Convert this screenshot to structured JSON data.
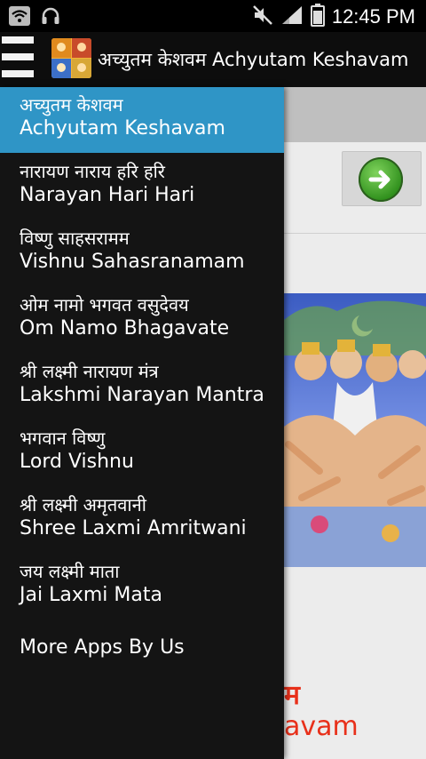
{
  "status_bar": {
    "time": "12:45 PM",
    "icons": [
      "wifi-icon",
      "headphones-icon",
      "mute-icon",
      "signal-icon",
      "battery-icon"
    ]
  },
  "action_bar": {
    "title": "अच्युतम केशवम Achyutam Keshavam",
    "icons": [
      "menu-icon",
      "app-icon"
    ]
  },
  "drawer": {
    "items": [
      {
        "hi": "अच्युतम केशवम",
        "en": "Achyutam Keshavam",
        "selected": true
      },
      {
        "hi": "नारायण नाराय हरि हरि",
        "en": "Narayan Hari Hari"
      },
      {
        "hi": "विष्णु साहसरामम",
        "en": "Vishnu Sahasranamam"
      },
      {
        "hi": "ओम नामो भगवत वसुदेवय",
        "en": "Om Namo Bhagavate"
      },
      {
        "hi": "श्री लक्ष्मी नारायण मंत्र",
        "en": "Lakshmi Narayan Mantra"
      },
      {
        "hi": "भगवान विष्णु",
        "en": "Lord Vishnu"
      },
      {
        "hi": "श्री लक्ष्मी अमृतवानी",
        "en": "Shree Laxmi Amritwani"
      },
      {
        "hi": "जय लक्ष्मी माता",
        "en": "Jai Laxmi Mata"
      }
    ],
    "more_apps": "More Apps By Us"
  },
  "content": {
    "title_hi_partial": "म",
    "title_en_partial": "avam",
    "next_icon": "arrow-right-icon"
  },
  "colors": {
    "selected_bg": "#2f95c6",
    "drawer_bg": "#141414",
    "title_red": "#e8301a"
  }
}
